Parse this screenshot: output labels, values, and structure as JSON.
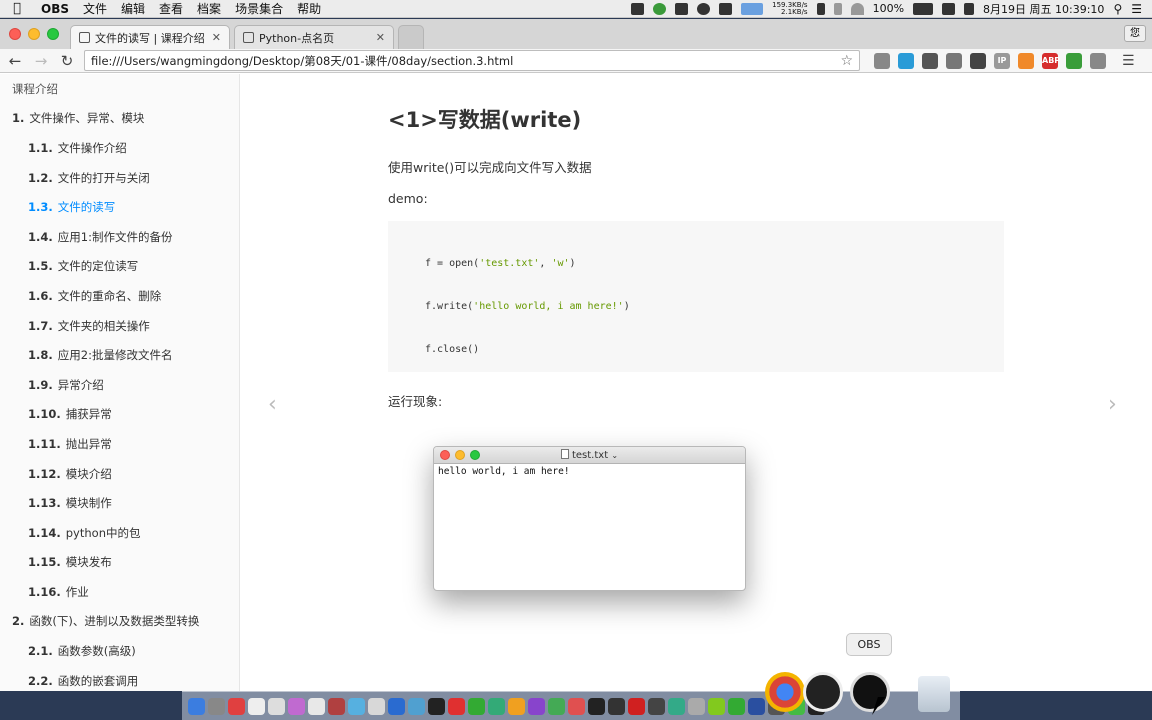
{
  "menubar": {
    "app_name": "OBS",
    "items": [
      "文件",
      "编辑",
      "查看",
      "档案",
      "场景集合",
      "帮助"
    ],
    "net_up": "159.3KB/s",
    "net_down": "2.1KB/s",
    "battery": "100%",
    "datetime": "8月19日 周五  10:39:10"
  },
  "browser": {
    "tabs": [
      {
        "label": "文件的读写 | 课程介绍",
        "active": true
      },
      {
        "label": "Python-点名页",
        "active": false
      }
    ],
    "profile_label": "您",
    "url": "file:///Users/wangmingdong/Desktop/第08天/01-课件/08day/section.3.html",
    "extensions": [
      {
        "name": "mail-ext",
        "color": "#888888",
        "text": ""
      },
      {
        "name": "shield-ext",
        "color": "#2a9bd7",
        "text": ""
      },
      {
        "name": "qr-ext",
        "color": "#555555",
        "text": ""
      },
      {
        "name": "cube-ext",
        "color": "#777777",
        "text": ""
      },
      {
        "name": "mask-ext",
        "color": "#444444",
        "text": ""
      },
      {
        "name": "ip-ext",
        "color": "#999999",
        "text": "IP"
      },
      {
        "name": "orange-ext",
        "color": "#f0892a",
        "text": ""
      },
      {
        "name": "abp-ext",
        "color": "#d62d2d",
        "text": "ABP"
      },
      {
        "name": "green-ext",
        "color": "#3a9d3a",
        "text": ""
      },
      {
        "name": "globe-ext",
        "color": "#888888",
        "text": ""
      }
    ]
  },
  "sidebar": {
    "intro": "课程介绍",
    "items": [
      {
        "num": "1.",
        "label": "文件操作、异常、模块",
        "level": 0,
        "active": false
      },
      {
        "num": "1.1.",
        "label": "文件操作介绍",
        "level": 1,
        "active": false
      },
      {
        "num": "1.2.",
        "label": "文件的打开与关闭",
        "level": 1,
        "active": false
      },
      {
        "num": "1.3.",
        "label": "文件的读写",
        "level": 1,
        "active": true
      },
      {
        "num": "1.4.",
        "label": "应用1:制作文件的备份",
        "level": 1,
        "active": false
      },
      {
        "num": "1.5.",
        "label": "文件的定位读写",
        "level": 1,
        "active": false
      },
      {
        "num": "1.6.",
        "label": "文件的重命名、删除",
        "level": 1,
        "active": false
      },
      {
        "num": "1.7.",
        "label": "文件夹的相关操作",
        "level": 1,
        "active": false
      },
      {
        "num": "1.8.",
        "label": "应用2:批量修改文件名",
        "level": 1,
        "active": false
      },
      {
        "num": "1.9.",
        "label": "异常介绍",
        "level": 1,
        "active": false
      },
      {
        "num": "1.10.",
        "label": "捕获异常",
        "level": 1,
        "active": false
      },
      {
        "num": "1.11.",
        "label": "抛出异常",
        "level": 1,
        "active": false
      },
      {
        "num": "1.12.",
        "label": "模块介绍",
        "level": 1,
        "active": false
      },
      {
        "num": "1.13.",
        "label": "模块制作",
        "level": 1,
        "active": false
      },
      {
        "num": "1.14.",
        "label": "python中的包",
        "level": 1,
        "active": false
      },
      {
        "num": "1.15.",
        "label": "模块发布",
        "level": 1,
        "active": false
      },
      {
        "num": "1.16.",
        "label": "作业",
        "level": 1,
        "active": false
      },
      {
        "num": "2.",
        "label": "函数(下)、进制以及数据类型转换",
        "level": 0,
        "active": false
      },
      {
        "num": "2.1.",
        "label": "函数参数(高级)",
        "level": 1,
        "active": false
      },
      {
        "num": "2.2.",
        "label": "函数的嵌套调用",
        "level": 1,
        "active": false
      }
    ]
  },
  "content": {
    "heading": "<1>写数据(write)",
    "desc": "使用write()可以完成向文件写入数据",
    "demo_label": "demo:",
    "code": {
      "line1_a": "f = open(",
      "line1_s1": "'test.txt'",
      "line1_b": ", ",
      "line1_s2": "'w'",
      "line1_c": ")",
      "line2_a": "f.write(",
      "line2_s": "'hello world, i am here!'",
      "line2_b": ")",
      "line3": "f.close()"
    },
    "result_label": "运行现象:",
    "prev_arrow": "‹",
    "next_arrow": "›"
  },
  "editor": {
    "title": "test.txt",
    "text": "hello world, i am here!"
  },
  "dock": {
    "tooltip": "OBS",
    "icons": [
      "#3b7de0",
      "#888",
      "#e04040",
      "#eee",
      "#ddd",
      "#c06ad0",
      "#e8e8e8",
      "#b04040",
      "#56b0e0",
      "#d8d8d8",
      "#2a6bd0",
      "#50a0d0",
      "#222",
      "#e03030",
      "#3a3",
      "#3a7",
      "#f0a020",
      "#8844cc",
      "#4a5",
      "#e05050",
      "#222",
      "#333",
      "#d02020",
      "#444",
      "#3a8",
      "#aaa",
      "#82c91e",
      "#3a3",
      "#2a4fa0",
      "#555",
      "#44bb44",
      "#222"
    ]
  }
}
